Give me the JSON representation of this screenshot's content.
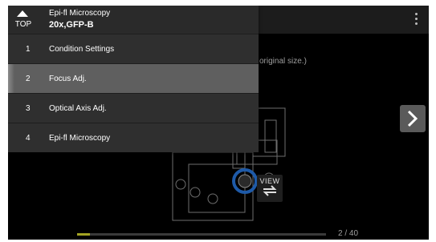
{
  "header": {
    "top_label": "TOP",
    "title": "Epi-fl Microscopy",
    "subtitle": "20x,GFP-B"
  },
  "menu": {
    "items": [
      {
        "num": "1",
        "label": "Condition Settings",
        "active": false
      },
      {
        "num": "2",
        "label": "Focus Adj.",
        "active": true
      },
      {
        "num": "3",
        "label": "Optical Axis Adj.",
        "active": false
      },
      {
        "num": "4",
        "label": "Epi-fl Microscopy",
        "active": false
      }
    ]
  },
  "content": {
    "hint_text": "original size.)",
    "view_label": "VIEW",
    "page_indicator": "2 / 40",
    "progress_fraction": 0.05
  },
  "colors": {
    "progress_fill": "#a4a423",
    "focus_ring": "#1e5aa8"
  }
}
